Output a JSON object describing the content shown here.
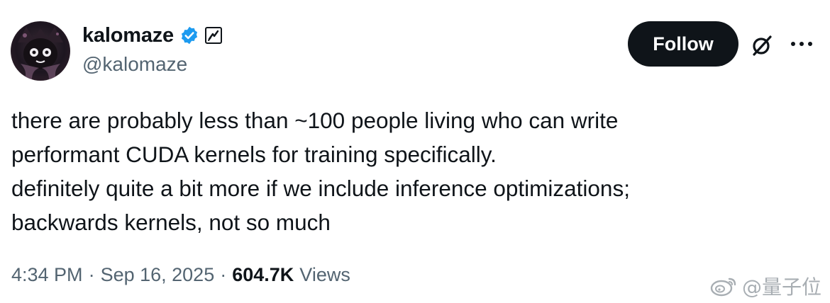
{
  "author": {
    "display_name": "kalomaze",
    "handle": "@kalomaze",
    "verified": true,
    "avatar_icon": "anime-character-avatar"
  },
  "actions": {
    "follow_label": "Follow",
    "grok_icon": "grok-icon",
    "more_icon": "more-icon"
  },
  "tweet": {
    "lines": [
      "there are probably less than ~100 people living who can write",
      "performant CUDA kernels for training specifically.",
      "definitely quite a bit more if we include inference optimizations;",
      "backwards kernels, not so much"
    ]
  },
  "meta": {
    "time": "4:34 PM",
    "separator": "·",
    "date": "Sep 16, 2025",
    "views_count": "604.7K",
    "views_label": "Views"
  },
  "watermark": {
    "text": "@量子位"
  },
  "colors": {
    "text_primary": "#0f1419",
    "text_secondary": "#536471",
    "verified_blue": "#1d9bf0",
    "follow_bg": "#0f1419"
  }
}
